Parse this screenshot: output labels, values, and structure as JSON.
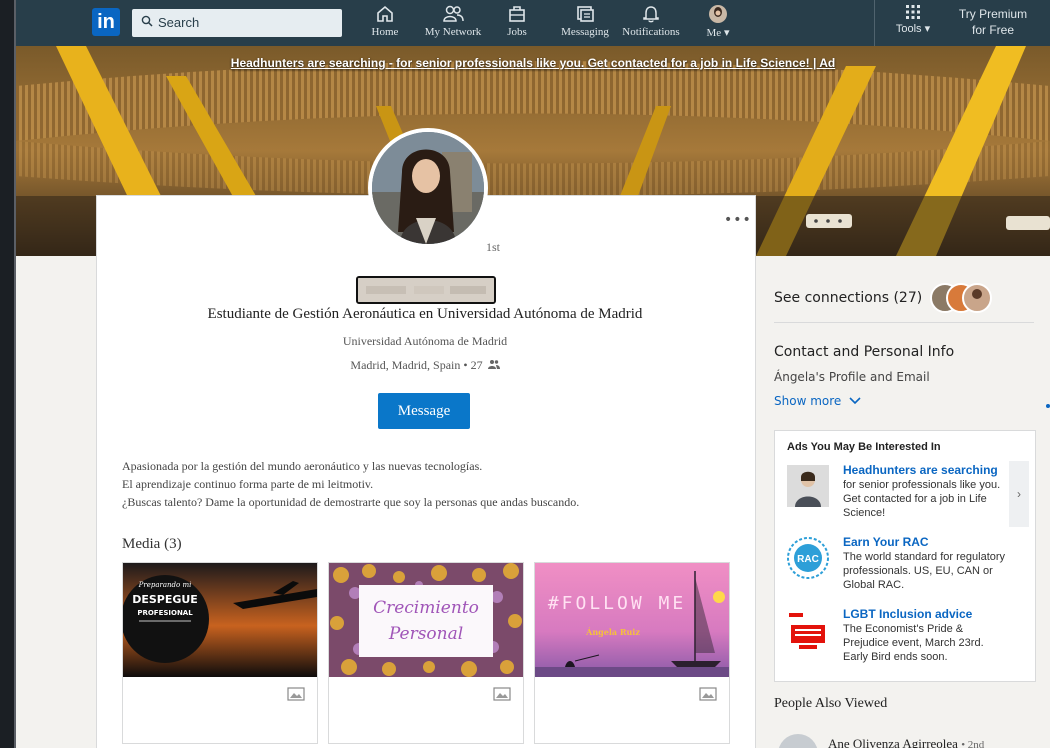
{
  "nav": {
    "logo": "in",
    "search_placeholder": "Search",
    "items": [
      {
        "label": "Home",
        "icon": "home-icon"
      },
      {
        "label": "My Network",
        "icon": "network-icon"
      },
      {
        "label": "Jobs",
        "icon": "jobs-icon"
      },
      {
        "label": "Messaging",
        "icon": "messaging-icon"
      },
      {
        "label": "Notifications",
        "icon": "bell-icon"
      },
      {
        "label": "Me ▾",
        "icon": "avatar-icon"
      }
    ],
    "tools_label": "Tools ▾",
    "premium_line1": "Try Premium",
    "premium_line2": "for Free"
  },
  "banner": {
    "ad_text": "Headhunters are searching - for senior professionals like you. Get contacted for a job in Life Science! | Ad"
  },
  "profile": {
    "degree": "1st",
    "headline": "Estudiante de Gestión Aeronáutica en Universidad Autónoma de Madrid",
    "school": "Universidad Autónoma de Madrid",
    "location": "Madrid, Madrid, Spain • 27",
    "message_button": "Message",
    "about": [
      "Apasionada por la gestión del mundo aeronáutico y las nuevas tecnologías.",
      "El aprendizaje continuo forma parte de mi leitmotiv.",
      "¿Buscas talento? Dame la oportunidad de demostrarte que soy la personas que andas buscando."
    ],
    "media_title": "Media (3)",
    "media": [
      {
        "line1": "Preparando mi",
        "line2": "DESPEGUE",
        "line3": "PROFESIONAL"
      },
      {
        "line1": "Crecimiento",
        "line2": "Personal"
      },
      {
        "line1": "#FOLLOW ME",
        "line2": "Ángela Ruiz"
      }
    ]
  },
  "rail": {
    "see_connections": "See connections (27)",
    "contact_heading": "Contact and Personal Info",
    "contact_sub": "Ángela's Profile and Email",
    "show_more": "Show more",
    "ads_heading": "Ads You May Be Interested In",
    "ads": [
      {
        "title": "Headhunters are searching",
        "desc": "for senior professionals like you. Get contacted for a job in Life Science!"
      },
      {
        "title": "Earn Your RAC",
        "desc": "The world standard for regulatory professionals. US, EU, CAN or Global RAC."
      },
      {
        "title": "LGBT Inclusion advice",
        "desc": "The Economist's Pride & Prejudice event, March 23rd. Early Bird ends soon."
      }
    ],
    "rac_logo": "RAC",
    "people_also_viewed": "People Also Viewed",
    "pav_name": "Ane Olivenza Agirreolea",
    "pav_degree": "• 2nd"
  },
  "colors": {
    "nav_bg": "#283e4a",
    "accent": "#0a66c2",
    "message_button": "#0a77c9"
  }
}
